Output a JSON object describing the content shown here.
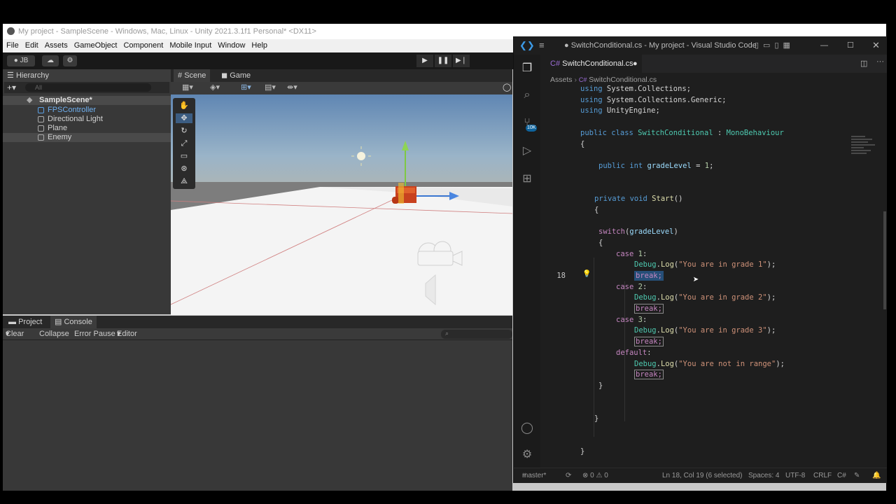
{
  "unity": {
    "title": "My project - SampleScene - Windows, Mac, Linux - Unity 2021.3.1f1 Personal* <DX11>",
    "menu": [
      "File",
      "Edit",
      "Assets",
      "GameObject",
      "Component",
      "Mobile Input",
      "Window",
      "Help"
    ],
    "account": "JB",
    "hierarchy": {
      "tab": "Hierarchy",
      "search_placeholder": "All",
      "scene": "SampleScene*",
      "items": [
        "FPSController",
        "Directional Light",
        "Plane",
        "Enemy"
      ]
    },
    "scene_tabs": [
      "Scene",
      "Game"
    ],
    "bottom_tabs": [
      "Project",
      "Console"
    ],
    "console_toolbar": {
      "clear": "Clear",
      "collapse": "Collapse",
      "error_pause": "Error Pause",
      "editor": "Editor"
    },
    "colors": {
      "sky_top": "#5f86b3",
      "ground": "#f2f2f2",
      "enemy": "#c8411e"
    }
  },
  "vscode": {
    "title": "● SwitchConditional.cs - My project - Visual Studio Code",
    "tab": "SwitchConditional.cs",
    "breadcrumb": {
      "folder": "Assets",
      "file": "SwitchConditional.cs"
    },
    "badge": "10K",
    "current_line": "18",
    "status": {
      "branch": "master*",
      "problems": "⊗ 0 ⚠ 0",
      "cursor": "Ln 18, Col 19 (6 selected)",
      "spaces": "Spaces: 4",
      "encoding": "UTF-8",
      "eol": "CRLF",
      "language": "C#"
    },
    "code": {
      "l1a": "using",
      "l1b": " System.Collections;",
      "l2a": "using",
      "l2b": " System.Collections.Generic;",
      "l3a": "using",
      "l3b": " UnityEngine;",
      "l5a": "public class",
      "l5b": " SwitchConditional",
      "l5c": " : ",
      "l5d": "MonoBehaviour",
      "l6": "{",
      "l8a": "public int",
      "l8b": " gradeLevel",
      "l8c": " = ",
      "l8d": "1",
      "l8e": ";",
      "l10a": "private void",
      "l10b": " Start",
      "l10c": "()",
      "l11": "{",
      "l13a": "switch",
      "l13b": "(",
      "l13c": "gradeLevel",
      "l13d": ")",
      "l14": "{",
      "l15a": "case",
      "l15b": " 1",
      "l15c": ":",
      "l16a": "Debug",
      "l16b": ".",
      "l16c": "Log",
      "l16d": "(",
      "l16e": "\"You are in grade 1\"",
      "l16f": ");",
      "l17": "break;",
      "l18a": "case",
      "l18b": " 2",
      "l18c": ":",
      "l19a": "Debug",
      "l19b": ".",
      "l19c": "Log",
      "l19d": "(",
      "l19e": "\"You are in grade 2\"",
      "l19f": ");",
      "l20": "break;",
      "l21a": "case",
      "l21b": " 3",
      "l21c": ":",
      "l22a": "Debug",
      "l22b": ".",
      "l22c": "Log",
      "l22d": "(",
      "l22e": "\"You are in grade 3\"",
      "l22f": ");",
      "l23": "break;",
      "l24a": "default",
      "l24b": ":",
      "l25a": "Debug",
      "l25b": ".",
      "l25c": "Log",
      "l25d": "(",
      "l25e": "\"You are not in range\"",
      "l25f": ");",
      "l26": "break;",
      "l27": "}",
      "l29": "}",
      "l31": "}"
    }
  }
}
